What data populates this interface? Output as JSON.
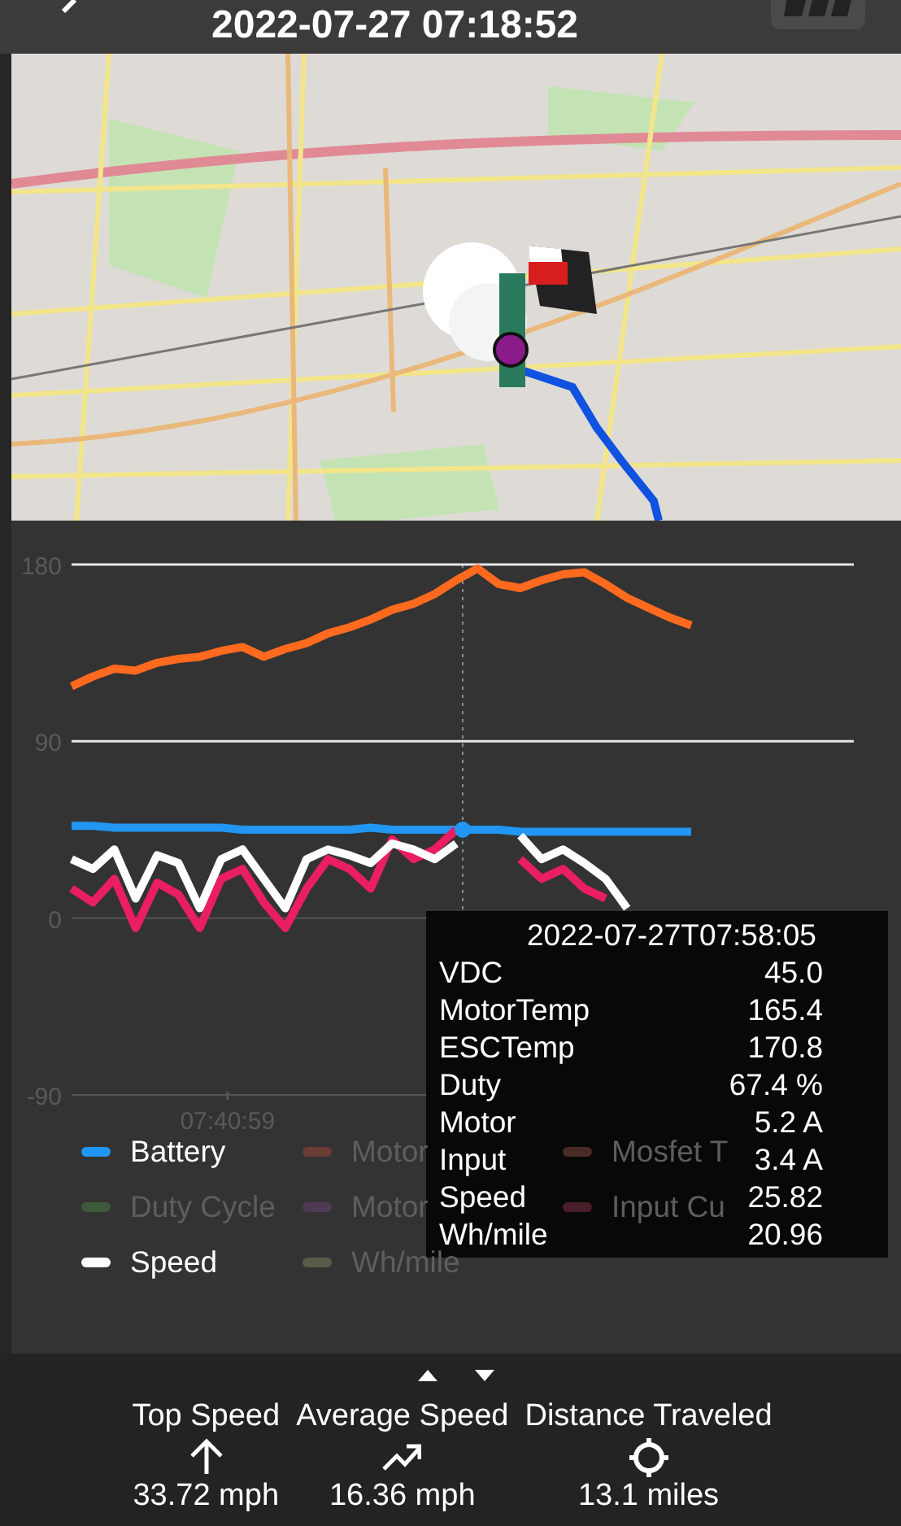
{
  "header": {
    "title": "2022-07-27 07:18:52"
  },
  "chart": {
    "chart_data": {
      "type": "line",
      "ylim": [
        -90,
        180
      ],
      "yticks": [
        {
          "value": 180,
          "label": "180"
        },
        {
          "value": 90,
          "label": "90"
        },
        {
          "value": 0,
          "label": "0"
        },
        {
          "value": -90,
          "label": "-90"
        }
      ],
      "annotations": [
        "07:40:59"
      ],
      "ref_lines": [
        {
          "axis": "y",
          "value": 180
        },
        {
          "axis": "y",
          "value": 90
        }
      ],
      "series": [
        {
          "color": "#ff6a1f",
          "values": [
            118,
            123,
            127,
            126,
            130,
            132,
            133,
            136,
            138,
            133,
            137,
            140,
            145,
            148,
            152,
            157,
            160,
            165,
            172,
            178,
            170,
            168,
            172,
            175,
            176,
            170,
            163,
            158,
            153,
            149
          ]
        },
        {
          "color": "#2196f3",
          "values": [
            47,
            47,
            46,
            46,
            46,
            46,
            46,
            46,
            45,
            45,
            45,
            45,
            45,
            45,
            46,
            45,
            45,
            45,
            45,
            45,
            45,
            44,
            44,
            44,
            44,
            44,
            44,
            44,
            44,
            44
          ]
        },
        {
          "color": "#e91e63",
          "values": [
            15,
            8,
            20,
            -5,
            18,
            12,
            -5,
            20,
            25,
            8,
            -5,
            15,
            30,
            25,
            15,
            40,
            30,
            35,
            45,
            null,
            null,
            30,
            20,
            25,
            15,
            10,
            null,
            null,
            null,
            null
          ]
        },
        {
          "color": "#ffffff",
          "values": [
            30,
            25,
            35,
            10,
            32,
            28,
            5,
            30,
            35,
            20,
            5,
            30,
            35,
            32,
            28,
            38,
            35,
            30,
            38,
            null,
            null,
            42,
            30,
            35,
            28,
            20,
            5,
            null,
            null,
            null
          ]
        }
      ]
    },
    "legend": [
      {
        "label": "Battery",
        "enabled": true,
        "color": "#2196f3"
      },
      {
        "label": "Motor",
        "enabled": false,
        "color": "#6b3c34"
      },
      {
        "label": "Mosfet T",
        "enabled": false,
        "color": "#4a2a22"
      },
      {
        "label": "Duty Cycle",
        "enabled": false,
        "color": "#3d5a3d"
      },
      {
        "label": "Motor",
        "enabled": false,
        "color": "#4e3a55"
      },
      {
        "label": "Input Cu",
        "enabled": false,
        "color": "#4a1e28"
      },
      {
        "label": "Speed",
        "enabled": true,
        "color": "#ffffff"
      },
      {
        "label": "Wh/mile",
        "enabled": false,
        "color": "#5a5a48"
      }
    ],
    "tooltip": {
      "title": "2022-07-27T07:58:05",
      "rows": [
        {
          "label": "VDC",
          "value": "45.0"
        },
        {
          "label": "MotorTemp",
          "value": "165.4"
        },
        {
          "label": "ESCTemp",
          "value": "170.8"
        },
        {
          "label": "Duty",
          "value": "67.4 %"
        },
        {
          "label": "Motor",
          "value": "5.2 A"
        },
        {
          "label": "Input",
          "value": "3.4 A"
        },
        {
          "label": "Speed",
          "value": "25.82"
        },
        {
          "label": "Wh/mile",
          "value": "20.96"
        }
      ]
    }
  },
  "stats": [
    {
      "kind": "up",
      "label": "Top Speed",
      "value": "33.72 mph"
    },
    {
      "kind": "trend",
      "label": "Average Speed",
      "value": "16.36 mph"
    },
    {
      "kind": "target",
      "label": "Distance Traveled",
      "value": "13.1 miles"
    }
  ]
}
